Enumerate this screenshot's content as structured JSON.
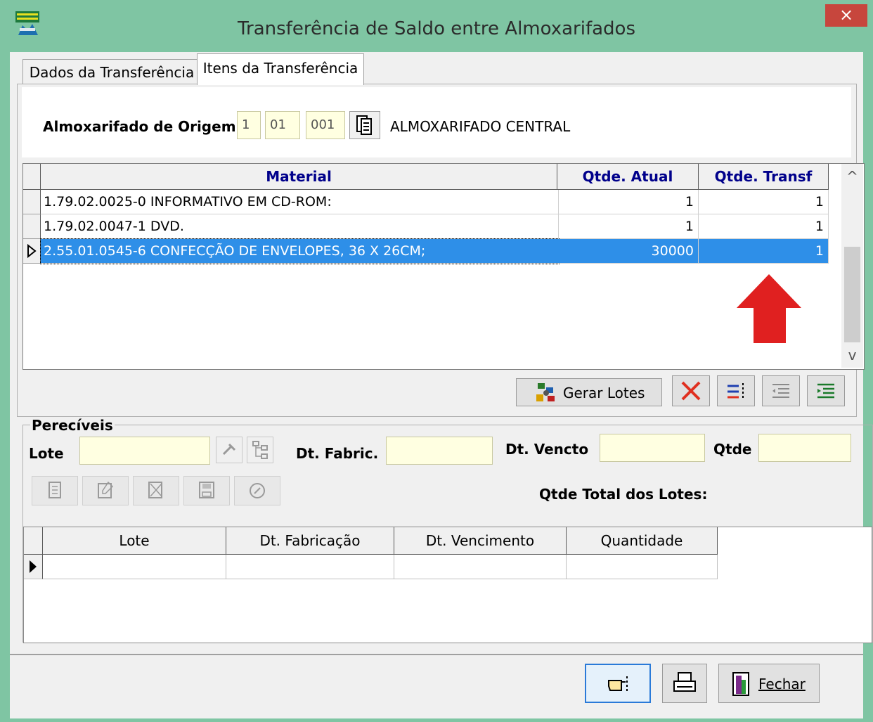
{
  "window": {
    "title": "Transferência de Saldo entre Almoxarifados",
    "close_label": "×",
    "app_icon": "app-icon"
  },
  "tabs": [
    {
      "label": "Dados da Transferência",
      "active": false
    },
    {
      "label": "Itens da Transferência",
      "active": true
    }
  ],
  "origem": {
    "label": "Almoxarifado de Origem",
    "code1": "1",
    "code2": "01",
    "code3": "001",
    "name": "ALMOXARIFADO CENTRAL",
    "lookup_icon": "lookup-icon"
  },
  "items_grid": {
    "columns": [
      "Material",
      "Qtde. Atual",
      "Qtde. Transf"
    ],
    "rows": [
      {
        "material": "1.79.02.0025-0 INFORMATIVO EM CD-ROM:",
        "atual": "1",
        "transf": "1",
        "selected": false
      },
      {
        "material": "1.79.02.0047-1 DVD.",
        "atual": "1",
        "transf": "1",
        "selected": false
      },
      {
        "material": "2.55.01.0545-6 CONFECÇÃO DE ENVELOPES, 36 X 26CM;",
        "atual": "30000",
        "transf": "1",
        "selected": true
      }
    ],
    "scroll_up": "^",
    "scroll_down": "v"
  },
  "toolbar": {
    "gerar_lotes_label": "Gerar Lotes"
  },
  "pereciveis": {
    "title": "Perecíveis",
    "lote_label": "Lote",
    "dt_fabric_label": "Dt. Fabric.",
    "dt_vencto_label": "Dt. Vencto",
    "qtde_label": "Qtde",
    "qtde_total_label": "Qtde Total dos Lotes:"
  },
  "lotes_grid": {
    "columns": [
      "Lote",
      "Dt. Fabricação",
      "Dt. Vencimento",
      "Quantidade"
    ]
  },
  "footer": {
    "fechar_label": "Fechar"
  },
  "colors": {
    "window_frame": "#7fc5a3",
    "selection": "#2e8fe8",
    "input_yellow": "#ffffe1",
    "arrow_red": "#e02020",
    "header_text": "#00008b"
  }
}
